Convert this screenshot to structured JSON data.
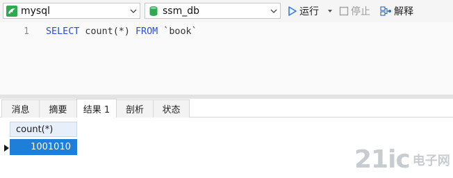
{
  "toolbar": {
    "connection": {
      "value": "mysql",
      "icon": "dolphin-icon"
    },
    "database": {
      "value": "ssm_db",
      "icon": "database-icon"
    },
    "run_label": "运行",
    "stop_label": "停止",
    "explain_label": "解释"
  },
  "editor": {
    "line_number": "1",
    "sql": {
      "kw1": "SELECT",
      "expr": " count(*) ",
      "kw2": "FROM",
      "table": " `book`"
    }
  },
  "tabs": [
    {
      "label": "消息"
    },
    {
      "label": "摘要"
    },
    {
      "label": "结果 1"
    },
    {
      "label": "剖析"
    },
    {
      "label": "状态"
    }
  ],
  "active_tab": "结果 1",
  "result": {
    "columns": [
      "count(*)"
    ],
    "rows": [
      [
        "1001010"
      ]
    ]
  },
  "watermark": {
    "big": "21ic",
    "small": "电子网"
  },
  "colors": {
    "keyword": "#2b4ed6",
    "selection": "#1f7ed8",
    "run_icon": "#2d7be0",
    "connection_icon": "#2fa84f",
    "database_icon": "#2fa84f"
  }
}
